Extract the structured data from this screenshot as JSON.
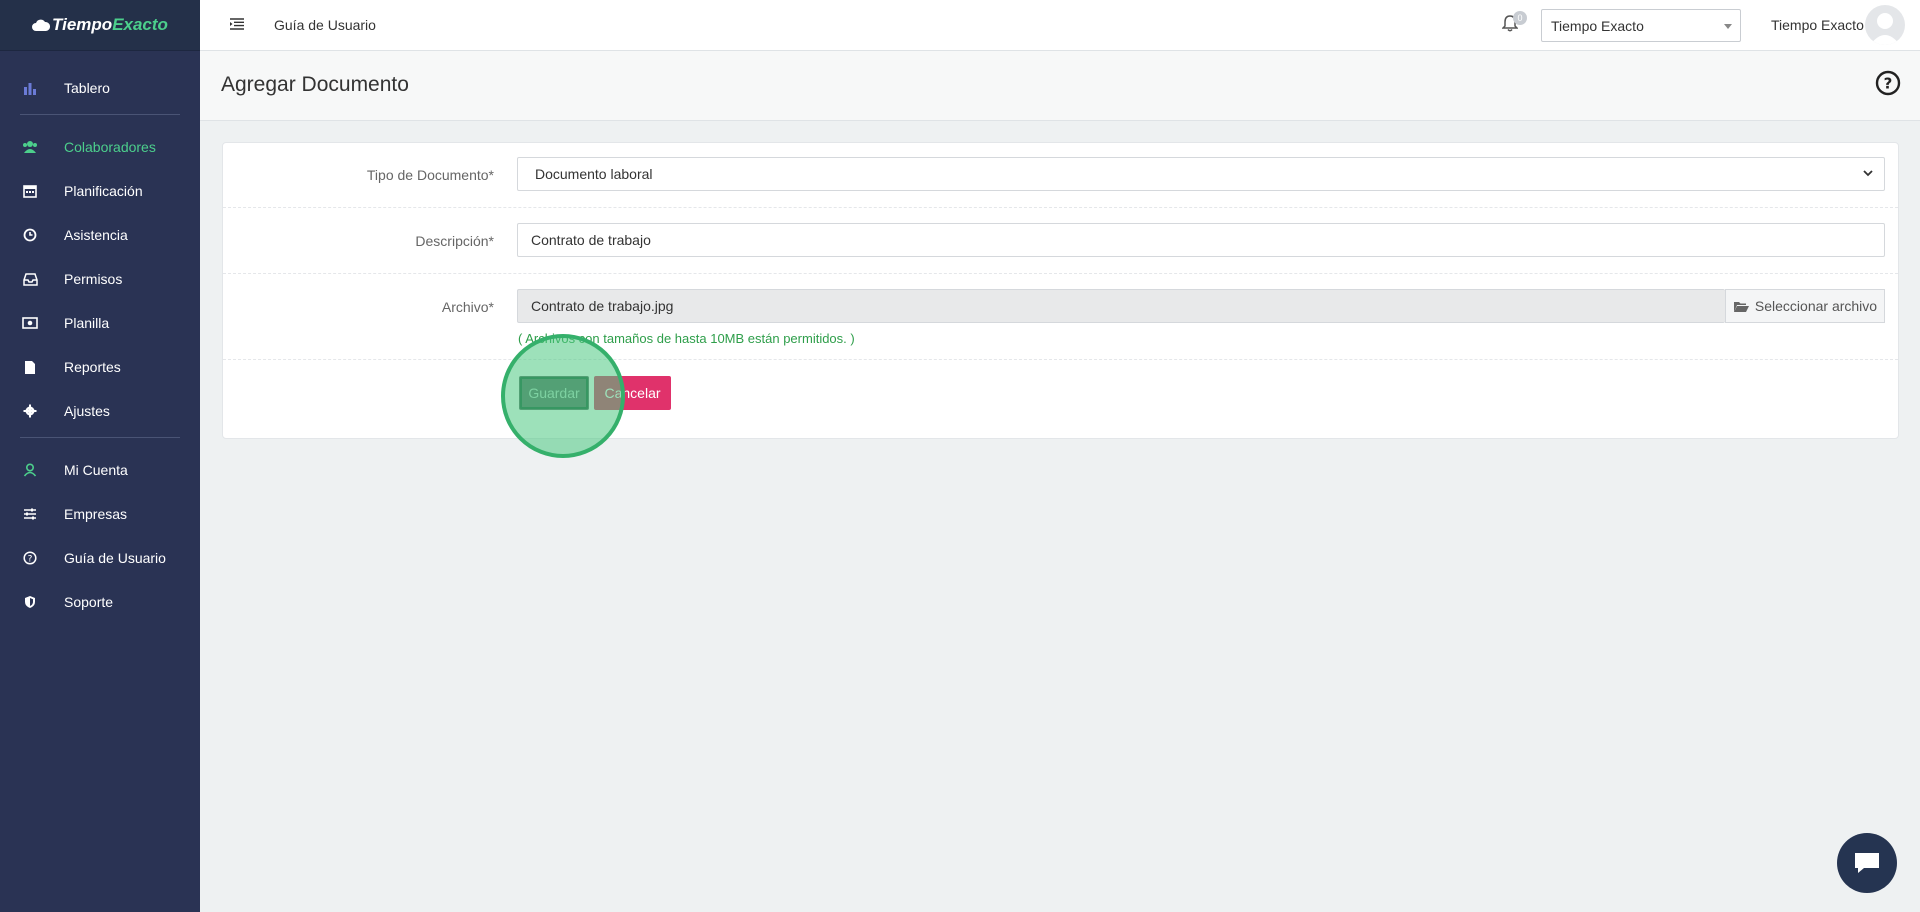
{
  "brand": {
    "part1": "Tiempo",
    "part2": "Exacto"
  },
  "sidebar": {
    "items": [
      {
        "label": "Tablero",
        "icon": "bar-chart-icon"
      },
      {
        "label": "Colaboradores",
        "icon": "users-icon",
        "active": true
      },
      {
        "label": "Planificación",
        "icon": "calendar-icon"
      },
      {
        "label": "Asistencia",
        "icon": "clock-icon"
      },
      {
        "label": "Permisos",
        "icon": "inbox-icon"
      },
      {
        "label": "Planilla",
        "icon": "money-icon"
      },
      {
        "label": "Reportes",
        "icon": "file-icon"
      },
      {
        "label": "Ajustes",
        "icon": "gear-icon"
      },
      {
        "label": "Mi Cuenta",
        "icon": "user-icon"
      },
      {
        "label": "Empresas",
        "icon": "sliders-icon"
      },
      {
        "label": "Guía de Usuario",
        "icon": "question-icon"
      },
      {
        "label": "Soporte",
        "icon": "shield-icon"
      }
    ]
  },
  "topbar": {
    "guide_link": "Guía de Usuario",
    "notifications_count": "0",
    "company_selected": "Tiempo Exacto",
    "user_name": "Tiempo Exacto"
  },
  "page": {
    "title": "Agregar Documento"
  },
  "form": {
    "doc_type_label": "Tipo de Documento*",
    "doc_type_value": "Documento laboral",
    "description_label": "Descripción*",
    "description_value": "Contrato de trabajo",
    "file_label": "Archivo*",
    "file_value": "Contrato de trabajo.jpg",
    "file_button": "Seleccionar archivo",
    "file_hint": "( Archivos con tamaños de hasta 10MB están permitidos. )",
    "save_button": "Guardar",
    "cancel_button": "Cancelar"
  },
  "colors": {
    "sidebar_bg": "#2a3354",
    "accent_green": "#4ccf8c",
    "cancel_pink": "#e0326b"
  }
}
